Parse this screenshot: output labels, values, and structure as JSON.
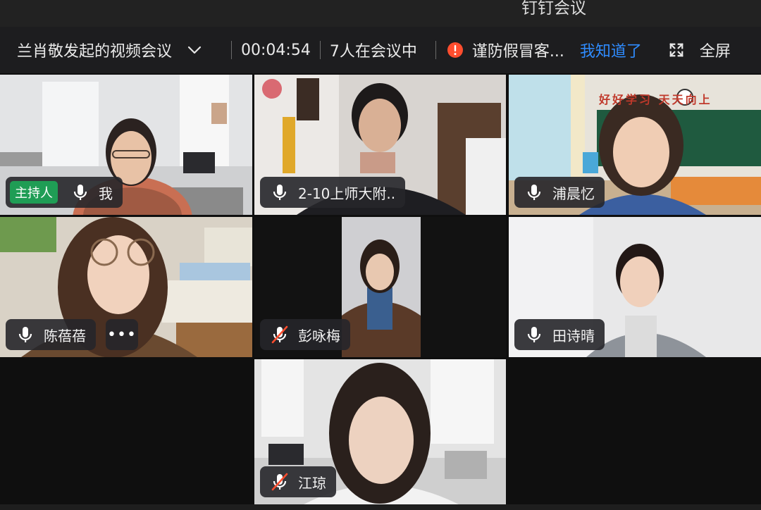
{
  "window": {
    "app_title": "钉钉会议"
  },
  "toolbar": {
    "meeting_title": "兰肖敬发起的视频会议",
    "timer": "00:04:54",
    "participant_count": "7人在会议中",
    "warning_text": "谨防假冒客...",
    "ack_label": "我知道了",
    "fullscreen_label": "全屏",
    "accent_color": "#2f8cff",
    "warning_color": "#ff4d2e"
  },
  "participants": [
    {
      "name": "我",
      "host_badge": "主持人",
      "mic": "on",
      "tile": "t1"
    },
    {
      "name": "2-10上师大附..",
      "mic": "on",
      "tile": "t2"
    },
    {
      "name": "浦晨忆",
      "mic": "on",
      "tile": "t3"
    },
    {
      "name": "陈蓓蓓",
      "mic": "on",
      "more": "•••",
      "tile": "t4"
    },
    {
      "name": "彭咏梅",
      "mic": "muted",
      "tile": "t5"
    },
    {
      "name": "田诗晴",
      "mic": "on",
      "tile": "t6"
    },
    {
      "name": "江琼",
      "mic": "muted",
      "tile": "t7"
    }
  ],
  "classroom_sign": "好好学习 天天向上",
  "host_badge_color": "#1f9d55"
}
